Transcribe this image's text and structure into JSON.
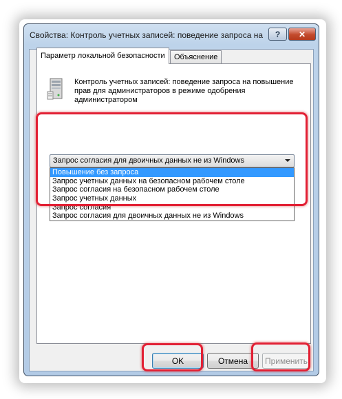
{
  "window": {
    "title": "Свойства: Контроль учетных записей: поведение запроса на...",
    "help_label": "?",
    "close_label": "✕"
  },
  "tabs": [
    {
      "label": "Параметр локальной безопасности",
      "active": true
    },
    {
      "label": "Объяснение",
      "active": false
    }
  ],
  "policy": {
    "icon": "server-icon",
    "description": "Контроль учетных записей: поведение запроса на повышение прав для администраторов в режиме одобрения администратором"
  },
  "combo": {
    "selected": "Запрос согласия для двоичных данных не из Windows",
    "options": [
      "Повышение без запроса",
      "Запрос учетных данных на безопасном рабочем столе",
      "Запрос согласия на безопасном рабочем столе",
      "Запрос учетных данных",
      "Запрос согласия",
      "Запрос согласия для двоичных данных не из Windows"
    ],
    "highlighted_index": 0
  },
  "buttons": {
    "ok": "OK",
    "cancel": "Отмена",
    "apply": "Применить"
  },
  "colors": {
    "highlight": "#e22034",
    "selection": "#3399ff"
  }
}
